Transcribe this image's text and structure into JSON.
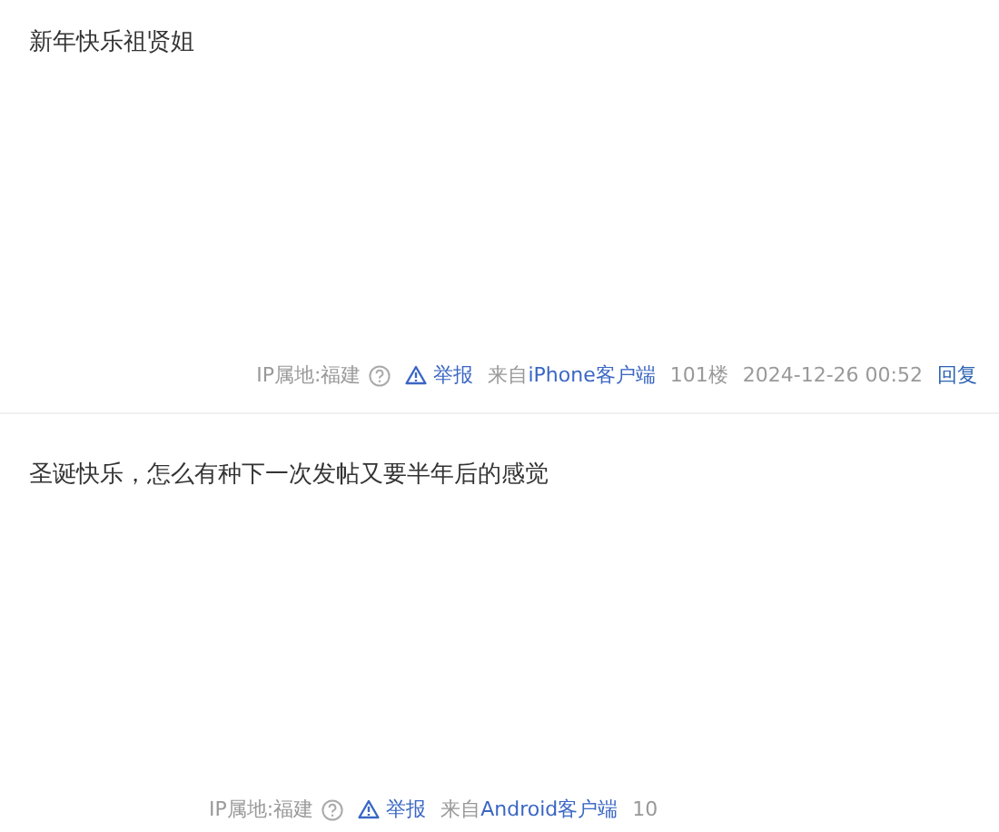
{
  "posts": [
    {
      "content": "新年快乐祖贤姐",
      "ip_label": "IP属地:福建",
      "report": "举报",
      "source_prefix": "来自",
      "source_link": "iPhone客户端",
      "floor": "101楼",
      "time": "2024-12-26 00:52",
      "reply": "回复"
    },
    {
      "content": "圣诞快乐，怎么有种下一次发帖又要半年后的感觉",
      "ip_label": "IP属地:福建",
      "report": "举报",
      "source_prefix": "来自",
      "source_link": "Android客户端",
      "floor": "10"
    }
  ]
}
